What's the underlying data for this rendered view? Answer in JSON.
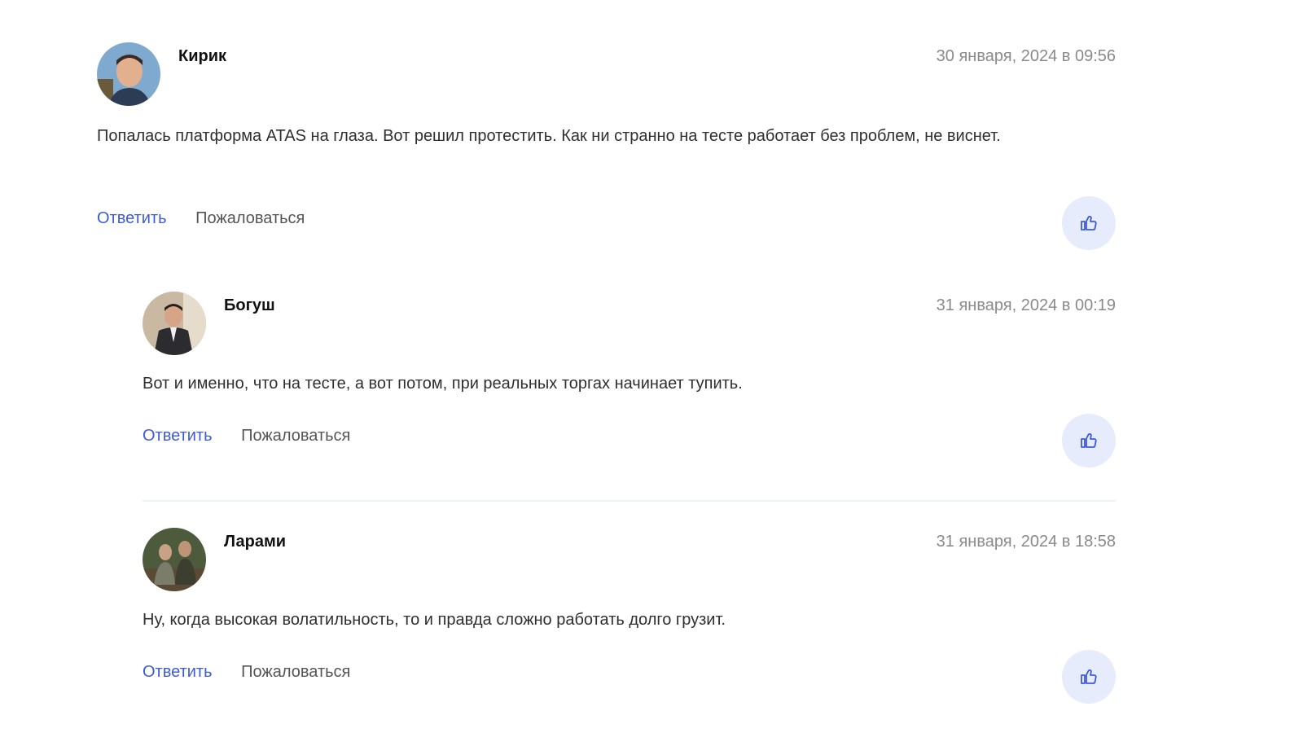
{
  "comments": [
    {
      "author": "Кирик",
      "date": "30 января, 2024 в 09:56",
      "text": "Попалась платформа ATAS на глаза. Вот решил протестить. Как ни странно на тесте работает без проблем, не виснет.",
      "reply_label": "Ответить",
      "report_label": "Пожаловаться"
    },
    {
      "author": "Богуш",
      "date": "31 января, 2024 в 00:19",
      "text": "Вот и именно, что на тесте, а вот потом, при реальных торгах начинает тупить.",
      "reply_label": "Ответить",
      "report_label": "Пожаловаться"
    },
    {
      "author": "Ларами",
      "date": "31 января, 2024 в 18:58",
      "text": "Ну, когда высокая волатильность, то и правда сложно работать долго грузит.",
      "reply_label": "Ответить",
      "report_label": "Пожаловаться"
    }
  ],
  "icons": {
    "like": "thumbs-up-icon"
  },
  "colors": {
    "link": "#3d5bd9",
    "like_bg": "#e6ecfb",
    "date": "#8a8a8a"
  }
}
